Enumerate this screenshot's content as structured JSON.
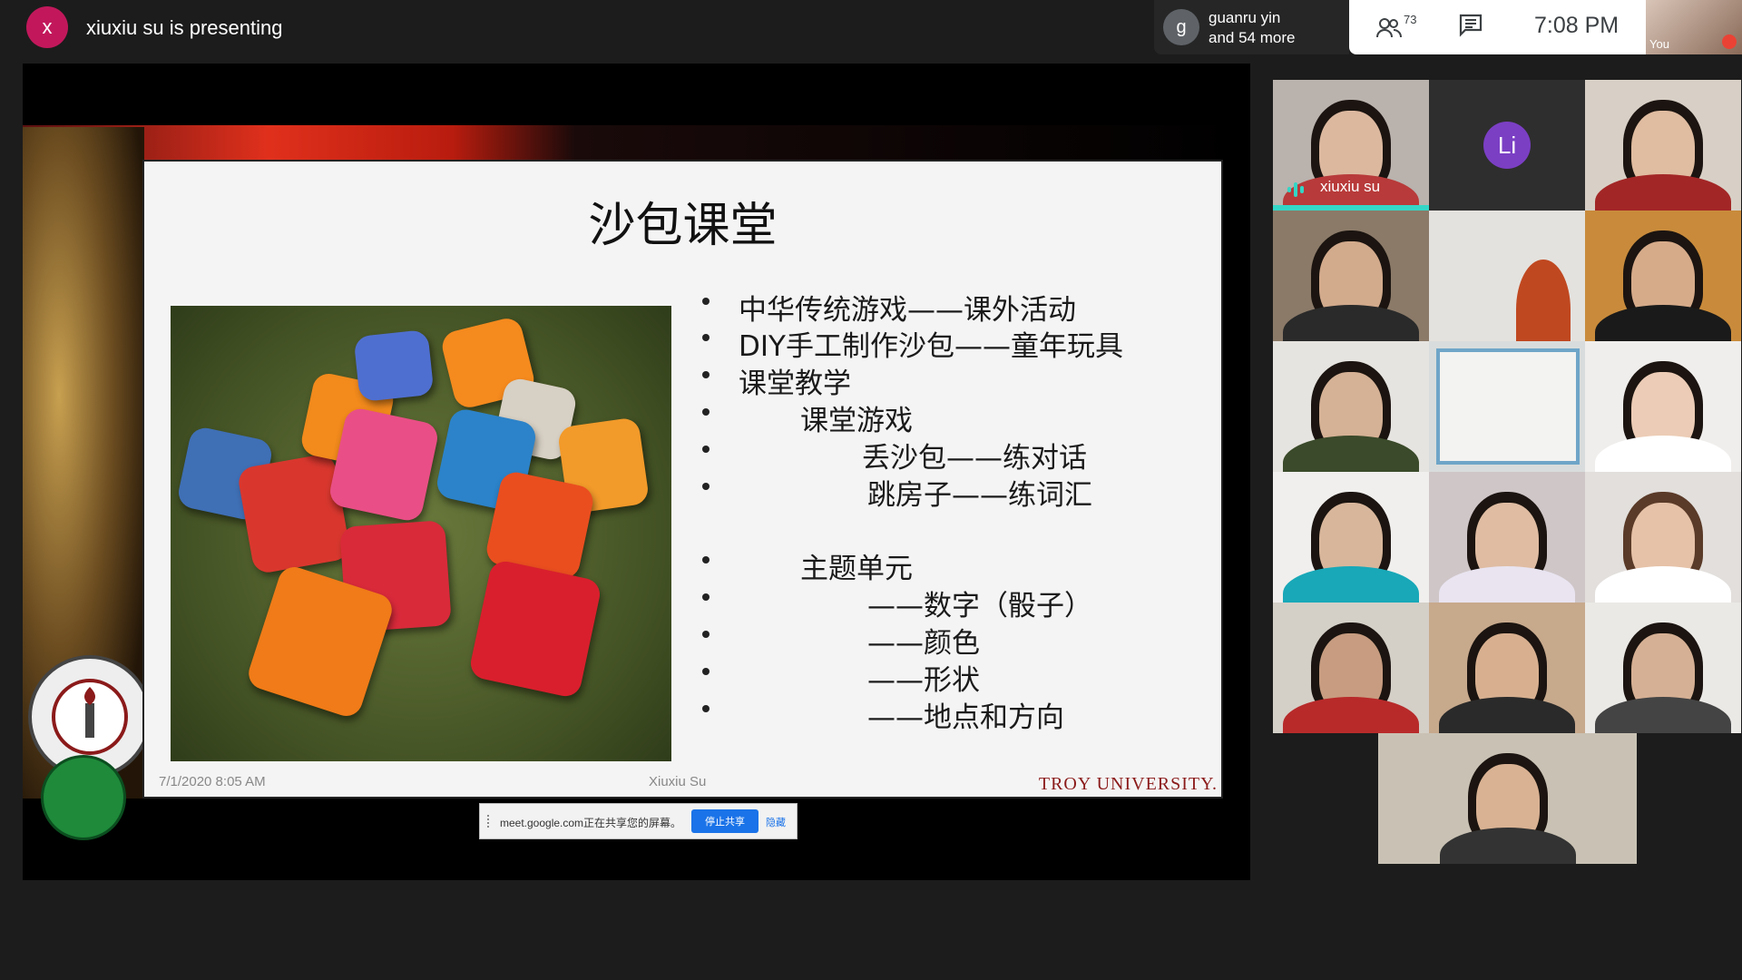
{
  "presenter": {
    "avatar_letter": "x",
    "text": "xiuxiu su is presenting"
  },
  "others": {
    "avatar_letter": "g",
    "line1": "guanru yin",
    "line2": "and 54 more"
  },
  "controls": {
    "participant_count": "73",
    "clock": "7:08 PM"
  },
  "self": {
    "label": "You"
  },
  "slide": {
    "title": "沙包课堂",
    "bullets": [
      {
        "text": "中华传统游戏——课外活动",
        "indent": 0
      },
      {
        "text": "DIY手工制作沙包——童年玩具",
        "indent": 0
      },
      {
        "text": "课堂教学",
        "indent": 0
      },
      {
        "text": "课堂游戏",
        "indent": 1
      },
      {
        "text": "丢沙包——练对话",
        "indent": 2
      },
      {
        "text": "跳房子——练词汇",
        "indent": 2
      },
      {
        "text": "主题单元",
        "indent": 1
      },
      {
        "text": "——数字（骰子）",
        "indent": 2
      },
      {
        "text": "——颜色",
        "indent": 2
      },
      {
        "text": "——形状",
        "indent": 2
      },
      {
        "text": "——地点和方向",
        "indent": 2
      }
    ],
    "date": "7/1/2020 8:05 AM",
    "author": "Xiuxiu Su",
    "logo": "TROY UNIVERSITY."
  },
  "share_banner": {
    "text": "meet.google.com正在共享您的屏幕。",
    "stop": "停止共享",
    "hide": "隐藏"
  },
  "participants": {
    "speaker_name": "xiuxiu su",
    "avatar_initials": "Li"
  },
  "colors": {
    "accent_teal": "#33d6c6",
    "presenter_avatar": "#c2185b",
    "li_avatar": "#7b3fc4",
    "share_button": "#1a73e8"
  }
}
